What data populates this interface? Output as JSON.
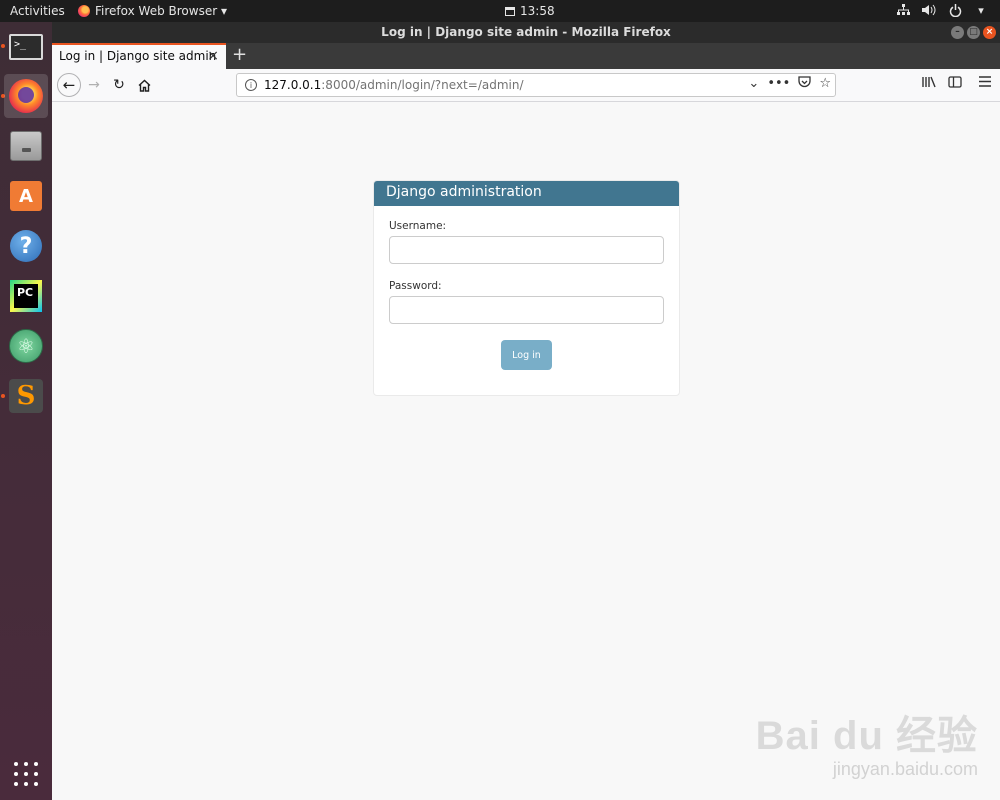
{
  "topbar": {
    "activities": "Activities",
    "app_menu": "Firefox Web Browser ▾",
    "clock": "13:58"
  },
  "dock": {
    "items": [
      {
        "name": "Terminal",
        "icon": "terminal-icon",
        "running": true
      },
      {
        "name": "Firefox Web Browser",
        "icon": "firefox-icon",
        "running": true
      },
      {
        "name": "Files",
        "icon": "files-icon"
      },
      {
        "name": "Ubuntu Software",
        "icon": "software-store-icon"
      },
      {
        "name": "Help",
        "icon": "help-icon"
      },
      {
        "name": "PyCharm",
        "icon": "pycharm-icon"
      },
      {
        "name": "Atom",
        "icon": "atom-icon"
      },
      {
        "name": "Sublime Text",
        "icon": "sublime-icon",
        "running": true
      }
    ],
    "terminal_glyph": ">_",
    "store_glyph": "A",
    "help_glyph": "?",
    "pycharm_glyph": "PC",
    "atom_glyph": "⚛",
    "sublime_glyph": "S"
  },
  "window": {
    "title": "Log in | Django site admin - Mozilla Firefox",
    "tab_title": "Log in | Django site admin",
    "url_host": "127.0.0.1",
    "url_path": ":8000/admin/login/?next=/admin/"
  },
  "login": {
    "header": "Django administration",
    "username_label": "Username:",
    "password_label": "Password:",
    "submit_label": "Log in"
  },
  "colors": {
    "django_header": "#417690",
    "button": "#79aec8",
    "ubuntu_orange": "#e95420"
  },
  "watermark": {
    "brand": "Bai du 经验",
    "url": "jingyan.baidu.com"
  }
}
